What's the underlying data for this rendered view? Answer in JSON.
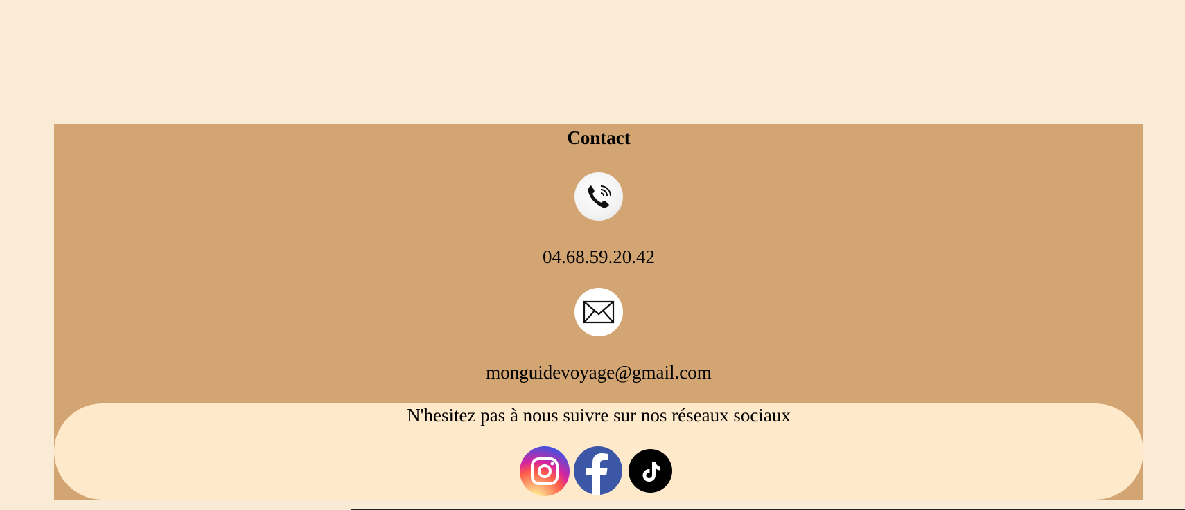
{
  "contact": {
    "title": "Contact",
    "phone_icon": "phone-icon",
    "phone_number": "04.68.59.20.42",
    "mail_icon": "envelope-icon",
    "email": "monguidevoyage@gmail.com"
  },
  "social": {
    "prompt": "N'hesitez pas à nous suivre sur nos réseaux sociaux",
    "links": [
      {
        "name": "instagram-icon"
      },
      {
        "name": "facebook-icon"
      },
      {
        "name": "tiktok-icon"
      }
    ]
  },
  "colors": {
    "page_background": "#faebd7",
    "contact_background": "#d2a572",
    "social_background": "#ffe9cb",
    "facebook_blue": "#3b57a6"
  }
}
